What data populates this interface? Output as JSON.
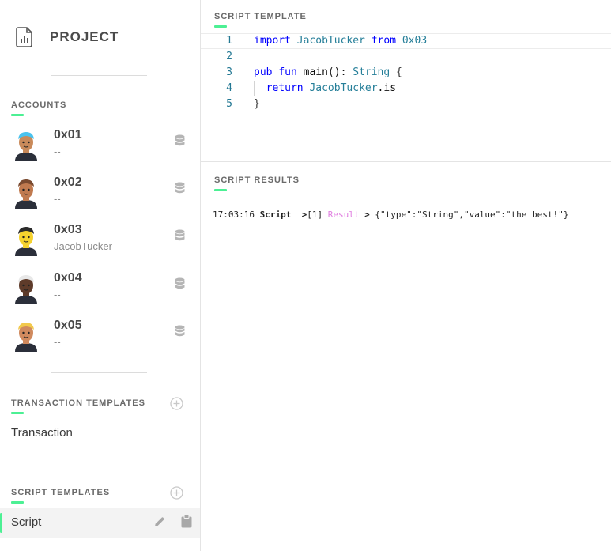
{
  "project": {
    "title": "PROJECT",
    "icon": "document-chart-icon"
  },
  "accounts": {
    "label": "ACCOUNTS",
    "items": [
      {
        "address": "0x01",
        "name": "--",
        "avatar": "avatar-blue-cap",
        "skin": "#c98a5a",
        "hair": "#4ac3ee"
      },
      {
        "address": "0x02",
        "name": "--",
        "avatar": "avatar-bald",
        "skin": "#c07a4f",
        "hair": "#7a4a2f"
      },
      {
        "address": "0x03",
        "name": "JacobTucker",
        "avatar": "avatar-yellow-eyepatch",
        "skin": "#f5d22e",
        "hair": "#2b2b2b"
      },
      {
        "address": "0x04",
        "name": "--",
        "avatar": "avatar-white-hair",
        "skin": "#5e3b2a",
        "hair": "#e8e8e8"
      },
      {
        "address": "0x05",
        "name": "--",
        "avatar": "avatar-blonde-glasses",
        "skin": "#d08a5e",
        "hair": "#f2c94c"
      }
    ]
  },
  "transaction_templates": {
    "label": "TRANSACTION TEMPLATES",
    "items": [
      "Transaction"
    ]
  },
  "script_templates": {
    "label": "SCRIPT TEMPLATES",
    "items": [
      "Script"
    ]
  },
  "editor": {
    "label": "SCRIPT TEMPLATE",
    "lines": [
      {
        "no": "1",
        "tokens": [
          {
            "t": "import",
            "c": "kw"
          },
          {
            "t": " JacobTucker ",
            "c": "ty"
          },
          {
            "t": "from",
            "c": "kw"
          },
          {
            "t": " 0x03",
            "c": "ty"
          }
        ]
      },
      {
        "no": "2",
        "tokens": []
      },
      {
        "no": "3",
        "tokens": [
          {
            "t": "pub",
            "c": "kw"
          },
          {
            "t": " ",
            "c": "tx"
          },
          {
            "t": "fun",
            "c": "kw"
          },
          {
            "t": " main(): ",
            "c": "tx"
          },
          {
            "t": "String",
            "c": "ty"
          },
          {
            "t": " {",
            "c": "brace"
          }
        ]
      },
      {
        "no": "4",
        "tokens": [
          {
            "t": "  ",
            "c": "tx"
          },
          {
            "t": "return",
            "c": "kw"
          },
          {
            "t": " JacobTucker",
            "c": "ty"
          },
          {
            "t": ".is",
            "c": "tx"
          }
        ]
      },
      {
        "no": "5",
        "tokens": [
          {
            "t": "}",
            "c": "brace"
          }
        ]
      }
    ]
  },
  "results": {
    "label": "SCRIPT RESULTS",
    "entries": [
      {
        "time": "17:03:16",
        "source": "Script",
        "index": "[1]",
        "kind": "Result",
        "value": "{\"type\":\"String\",\"value\":\"the best!\"}"
      }
    ]
  },
  "colors": {
    "accent": "#4cf094",
    "keyword": "#0000ff",
    "type": "#267f99",
    "result_label": "#e07ee0"
  }
}
